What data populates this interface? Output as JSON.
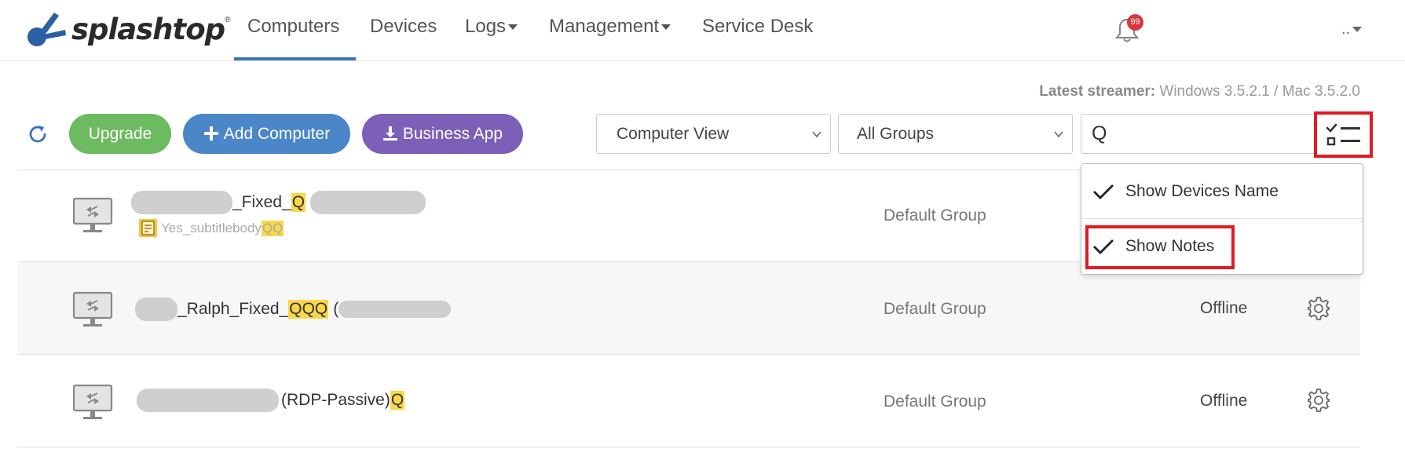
{
  "brand": {
    "name": "splashtop",
    "registered": "®",
    "color": "#2b5fa6"
  },
  "nav": {
    "items": [
      {
        "label": "Computers",
        "active": true
      },
      {
        "label": "Devices"
      },
      {
        "label": "Logs",
        "has_caret": true
      },
      {
        "label": "Management",
        "has_caret": true
      },
      {
        "label": "Service Desk"
      }
    ],
    "notifications_count": "99",
    "user_label": ".."
  },
  "streamer": {
    "label": "Latest streamer:",
    "windows": "Windows 3.5.2.1",
    "separator": "/",
    "mac": "Mac 3.5.2.0"
  },
  "toolbar": {
    "upgrade": "Upgrade",
    "add_computer": "Add Computer",
    "business_app": "Business App",
    "view_select": "Computer View",
    "group_select": "All Groups",
    "search_value": "Q"
  },
  "rows": [
    {
      "name_mid": "_Fixed_",
      "name_hl": "Q",
      "note_text": "Yes_subtitlebody",
      "note_hl": "QQ",
      "group": "Default Group",
      "status": ""
    },
    {
      "name_mid": "_Ralph_Fixed_",
      "name_hl": "QQQ",
      "name_paren": "(",
      "group": "Default Group",
      "status": "Offline"
    },
    {
      "name_mid": "(RDP-Passive)",
      "name_hl": "Q",
      "group": "Default Group",
      "status": "Offline"
    }
  ],
  "dropdown": {
    "items": [
      {
        "label": "Show Devices Name",
        "checked": true
      },
      {
        "label": "Show Notes",
        "checked": true
      }
    ]
  },
  "colors": {
    "accent": "#3b73b9",
    "highlight": "#f8d84a",
    "annotation": "#e21b23",
    "green": "#6cbb60",
    "blue": "#4a86c8",
    "purple": "#7c5fb7"
  }
}
